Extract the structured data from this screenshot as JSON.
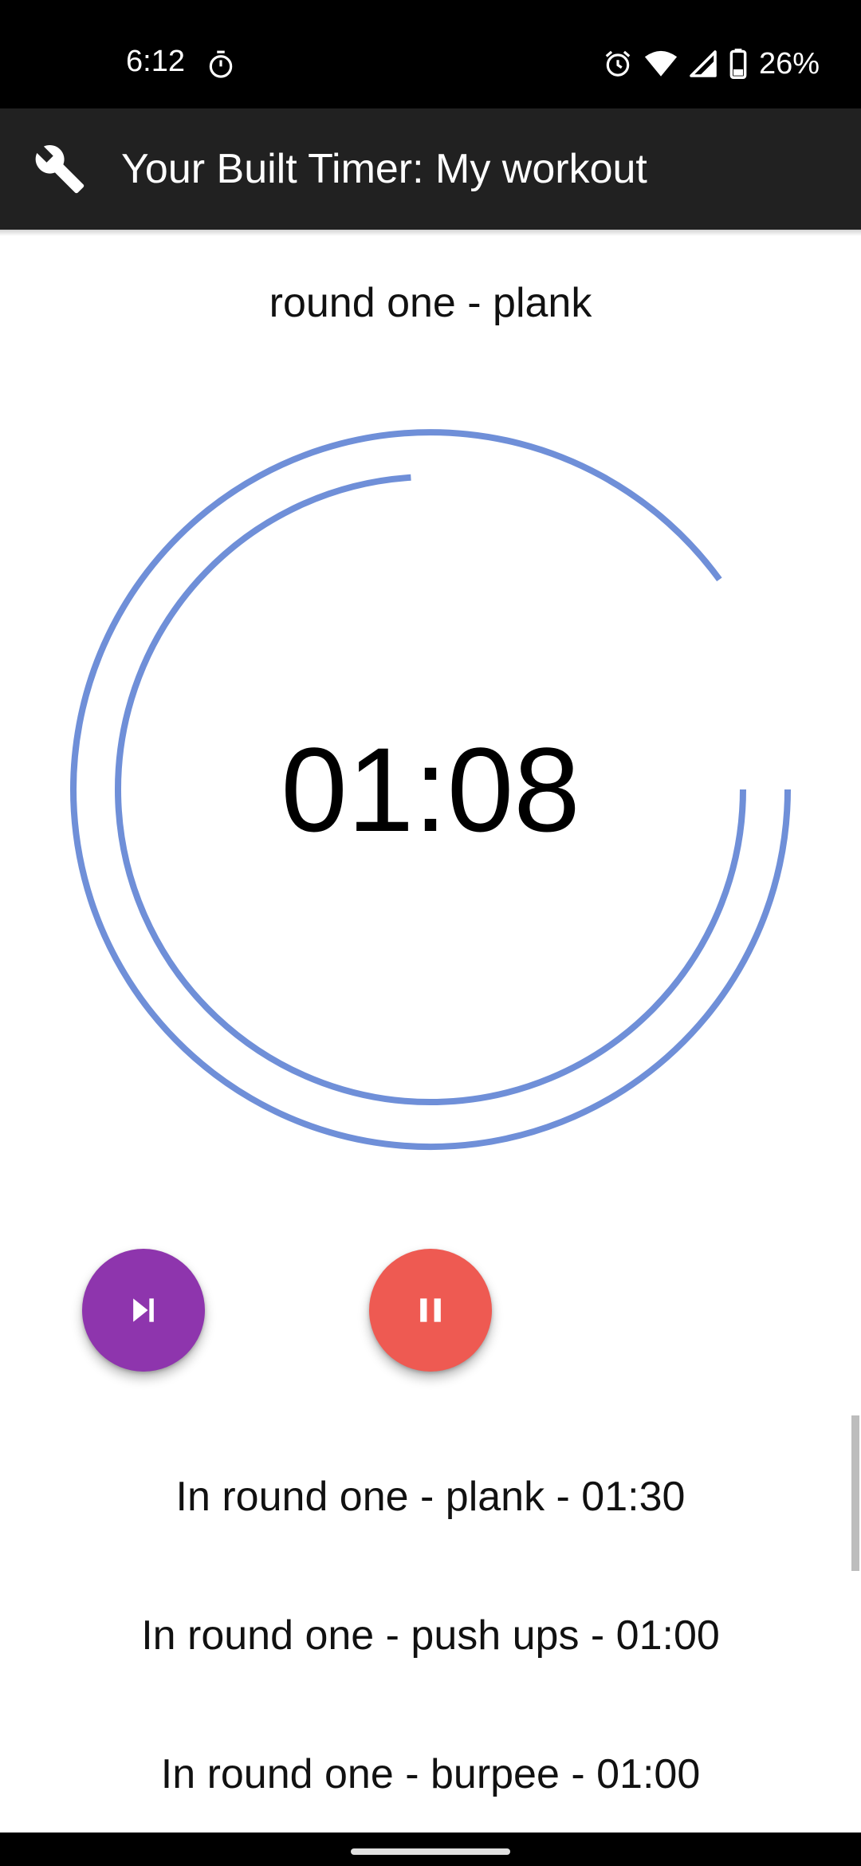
{
  "status_bar": {
    "time": "6:12",
    "battery_percent": "26%",
    "icons": [
      "timer-icon",
      "alarm-icon",
      "wifi-icon",
      "signal-icon",
      "battery-icon"
    ]
  },
  "app_bar": {
    "icon": "wrench-icon",
    "title": "Your Built Timer: My workout",
    "background": "#212121"
  },
  "timer": {
    "current_round": "round one - plank",
    "remaining": "01:08",
    "ring_color": "#6f8fd8",
    "outer_progress": 0.9,
    "inner_progress": 0.74
  },
  "controls": {
    "skip": {
      "icon": "skip-next-icon",
      "color": "#8e35ad"
    },
    "pause": {
      "icon": "pause-icon",
      "color": "#ee5a52"
    }
  },
  "schedule": [
    "In round one - plank - 01:30",
    "In round one - push ups - 01:00",
    "In round one - burpee - 01:00"
  ]
}
